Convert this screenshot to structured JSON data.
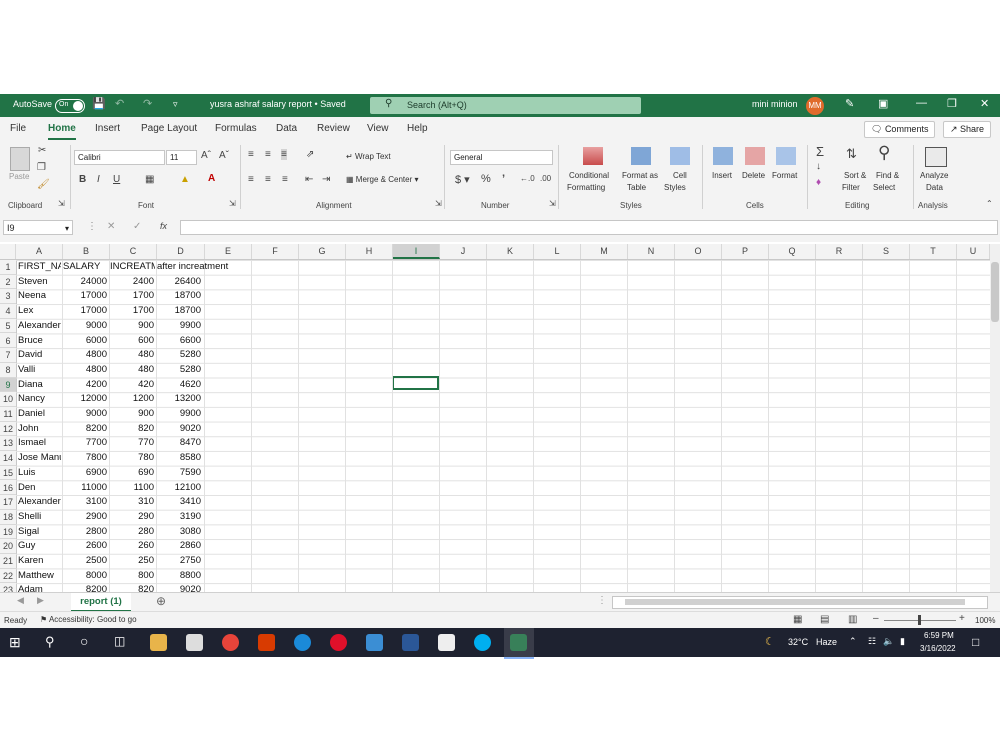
{
  "titlebar": {
    "autosave": "AutoSave",
    "toggle": "On",
    "doc_title": "yusra ashraf salary report • Saved",
    "search_placeholder": "Search (Alt+Q)",
    "user_name": "mini minion",
    "user_initials": "MM"
  },
  "menu": [
    "File",
    "Home",
    "Insert",
    "Page Layout",
    "Formulas",
    "Data",
    "Review",
    "View",
    "Help"
  ],
  "menu_buttons": {
    "comments": "Comments",
    "share": "Share"
  },
  "ribbon": {
    "paste": "Paste",
    "font_name": "Calibri",
    "font_size": "11",
    "wrap_text": "Wrap Text",
    "merge_center": "Merge & Center",
    "number_format": "General",
    "conditional": [
      "Conditional",
      "Formatting"
    ],
    "format_table": [
      "Format as",
      "Table"
    ],
    "cell_styles": [
      "Cell",
      "Styles"
    ],
    "insert": "Insert",
    "delete": "Delete",
    "format": "Format",
    "sort_filter": [
      "Sort &",
      "Filter"
    ],
    "find_select": [
      "Find &",
      "Select"
    ],
    "analyze": [
      "Analyze",
      "Data"
    ],
    "groups": [
      "Clipboard",
      "Font",
      "Alignment",
      "Number",
      "Styles",
      "Cells",
      "Editing",
      "Analysis"
    ]
  },
  "formula_bar": {
    "name_box": "I9",
    "fx": "fx"
  },
  "columns": [
    "A",
    "B",
    "C",
    "D",
    "E",
    "F",
    "G",
    "H",
    "I",
    "J",
    "K",
    "L",
    "M",
    "N",
    "O",
    "P",
    "Q",
    "R",
    "S",
    "T",
    "U"
  ],
  "selected_column": "I",
  "selected_row": 9,
  "rows": [
    {
      "n": 1,
      "a": "FIRST_NA",
      "b": "SALARY",
      "c": "INCREATM",
      "d": "after increatment"
    },
    {
      "n": 2,
      "a": "Steven",
      "b": "24000",
      "c": "2400",
      "d": "26400"
    },
    {
      "n": 3,
      "a": "Neena",
      "b": "17000",
      "c": "1700",
      "d": "18700"
    },
    {
      "n": 4,
      "a": "Lex",
      "b": "17000",
      "c": "1700",
      "d": "18700"
    },
    {
      "n": 5,
      "a": "Alexander",
      "b": "9000",
      "c": "900",
      "d": "9900"
    },
    {
      "n": 6,
      "a": "Bruce",
      "b": "6000",
      "c": "600",
      "d": "6600"
    },
    {
      "n": 7,
      "a": "David",
      "b": "4800",
      "c": "480",
      "d": "5280"
    },
    {
      "n": 8,
      "a": "Valli",
      "b": "4800",
      "c": "480",
      "d": "5280"
    },
    {
      "n": 9,
      "a": "Diana",
      "b": "4200",
      "c": "420",
      "d": "4620"
    },
    {
      "n": 10,
      "a": "Nancy",
      "b": "12000",
      "c": "1200",
      "d": "13200"
    },
    {
      "n": 11,
      "a": "Daniel",
      "b": "9000",
      "c": "900",
      "d": "9900"
    },
    {
      "n": 12,
      "a": "John",
      "b": "8200",
      "c": "820",
      "d": "9020"
    },
    {
      "n": 13,
      "a": "Ismael",
      "b": "7700",
      "c": "770",
      "d": "8470"
    },
    {
      "n": 14,
      "a": "Jose Manuel",
      "b": "7800",
      "c": "780",
      "d": "8580"
    },
    {
      "n": 15,
      "a": "Luis",
      "b": "6900",
      "c": "690",
      "d": "7590"
    },
    {
      "n": 16,
      "a": "Den",
      "b": "11000",
      "c": "1100",
      "d": "12100"
    },
    {
      "n": 17,
      "a": "Alexander",
      "b": "3100",
      "c": "310",
      "d": "3410"
    },
    {
      "n": 18,
      "a": "Shelli",
      "b": "2900",
      "c": "290",
      "d": "3190"
    },
    {
      "n": 19,
      "a": "Sigal",
      "b": "2800",
      "c": "280",
      "d": "3080"
    },
    {
      "n": 20,
      "a": "Guy",
      "b": "2600",
      "c": "260",
      "d": "2860"
    },
    {
      "n": 21,
      "a": "Karen",
      "b": "2500",
      "c": "250",
      "d": "2750"
    },
    {
      "n": 22,
      "a": "Matthew",
      "b": "8000",
      "c": "800",
      "d": "8800"
    },
    {
      "n": 23,
      "a": "Adam",
      "b": "8200",
      "c": "820",
      "d": "9020"
    }
  ],
  "sheet_tab": "report (1)",
  "status": {
    "ready": "Ready",
    "accessibility": "Accessibility: Good to go",
    "zoom": "100%"
  },
  "taskbar": {
    "temp": "32°C",
    "weather": "Haze",
    "time": "6:59 PM",
    "date": "3/16/2022"
  },
  "colors": {
    "excel_green": "#217346",
    "avatar": "#e06b2c",
    "taskbar": "#1e2230"
  }
}
